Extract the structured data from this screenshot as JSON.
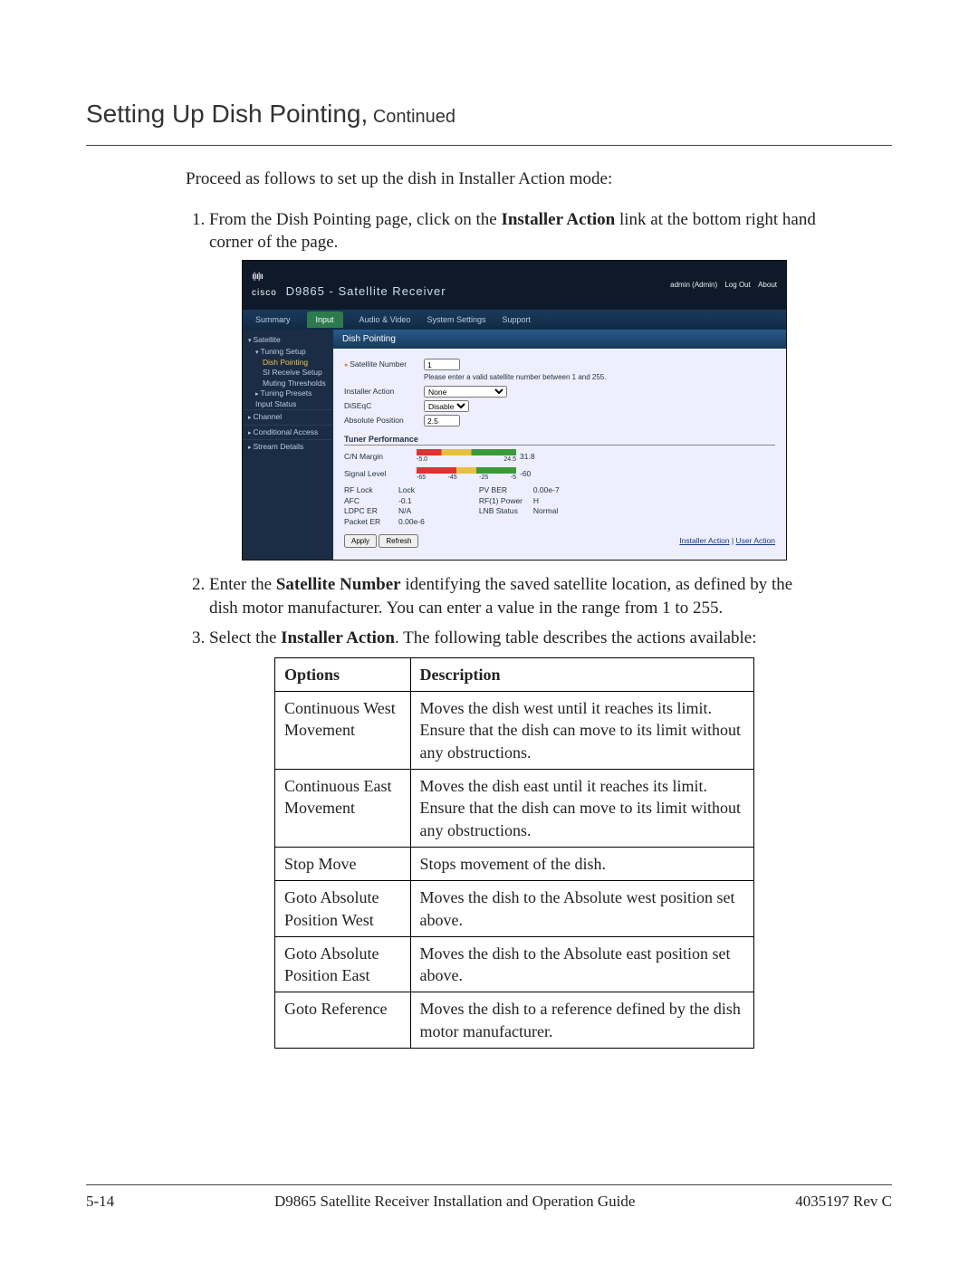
{
  "title": {
    "main": "Setting Up Dish Pointing,",
    "continued": " Continued"
  },
  "intro": "Proceed as follows to set up the dish in Installer Action mode:",
  "step1": {
    "prefix": "From the Dish Pointing page, click on the ",
    "bold": "Installer Action",
    "suffix": " link at the bottom right hand corner of the page."
  },
  "step2": {
    "prefix": "Enter the ",
    "bold": "Satellite Number",
    "suffix": " identifying the saved satellite location, as defined by the dish motor manufacturer. You can enter a value in the range from 1 to 255."
  },
  "step3": {
    "prefix": "Select the ",
    "bold": "Installer Action",
    "suffix": ". The following table describes the actions available:"
  },
  "screenshot": {
    "product": "D9865 - Satellite Receiver",
    "logo_text": "cisco",
    "header_right": {
      "admin": "admin (Admin)",
      "logout": "Log Out",
      "about": "About"
    },
    "tabs": [
      "Summary",
      "Input",
      "Audio & Video",
      "System Settings",
      "Support"
    ],
    "sidebar": {
      "satellite": "Satellite",
      "tuning_setup": "Tuning Setup",
      "dish_pointing": "Dish Pointing",
      "si_receive": "SI Receive Setup",
      "muting": "Muting Thresholds",
      "tuning_presets": "Tuning Presets",
      "input_status": "Input Status",
      "channel": "Channel",
      "conditional": "Conditional Access",
      "stream": "Stream Details"
    },
    "content": {
      "heading": "Dish Pointing",
      "sat_num_label": "Satellite Number",
      "sat_num_value": "1",
      "sat_hint": "Please enter a valid satellite number between 1 and 255.",
      "inst_action_label": "Installer Action",
      "inst_action_value": "None",
      "diseqc_label": "DiSEqC",
      "diseqc_value": "Disable",
      "abs_pos_label": "Absolute Position",
      "abs_pos_value": "2.5",
      "tuner_perf": "Tuner Performance",
      "cn_margin": "C/N Margin",
      "cn_ticks": [
        "-5.0",
        "",
        "",
        "24.5"
      ],
      "cn_extra": "31.8",
      "signal_level": "Signal Level",
      "sig_ticks": [
        "-65",
        "-45",
        "-25",
        "-5"
      ],
      "sig_readout": "-60",
      "kv": {
        "rf_lock_k": "RF Lock",
        "rf_lock_v": "Lock",
        "afc_k": "AFC",
        "afc_v": "-0.1",
        "ldpc_k": "LDPC ER",
        "ldpc_v": "N/A",
        "packet_k": "Packet ER",
        "packet_v": "0.00e-6",
        "pvber_k": "PV BER",
        "pvber_v": "0.00e-7",
        "rfpower_k": "RF(1) Power",
        "rfpower_v": "H",
        "lnb_k": "LNB Status",
        "lnb_v": "Normal"
      },
      "buttons": {
        "apply": "Apply",
        "refresh": "Refresh"
      },
      "links": {
        "installer": "Installer Action",
        "user": "User Action"
      }
    }
  },
  "table": {
    "headers": {
      "options": "Options",
      "description": "Description"
    },
    "rows": [
      {
        "opt": "Continuous West Movement",
        "desc": "Moves the dish west until it reaches its limit. Ensure that the dish can move to its limit without any obstructions."
      },
      {
        "opt": "Continuous East Movement",
        "desc": "Moves the dish east until it reaches its limit. Ensure that the dish can move to its limit without any obstructions."
      },
      {
        "opt": "Stop Move",
        "desc": "Stops movement of the dish."
      },
      {
        "opt": "Goto Absolute Position West",
        "desc": "Moves the dish to the Absolute west position set above."
      },
      {
        "opt": "Goto Absolute Position East",
        "desc": "Moves the dish to the Absolute east position set above."
      },
      {
        "opt": "Goto Reference",
        "desc": "Moves the dish to a reference defined by the dish motor manufacturer."
      }
    ]
  },
  "footer": {
    "page": "5-14",
    "doc": "D9865 Satellite Receiver Installation and Operation Guide",
    "rev": "4035197 Rev C"
  }
}
